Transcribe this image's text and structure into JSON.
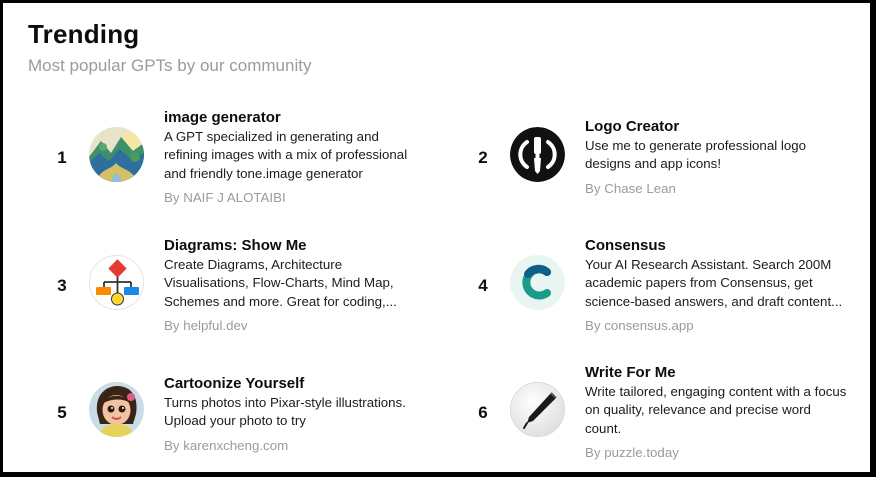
{
  "header": {
    "title": "Trending",
    "subtitle": "Most popular GPTs by our community"
  },
  "items": [
    {
      "rank": "1",
      "name": "image generator",
      "description": "A GPT specialized in generating and refining images with a mix of professional and friendly tone.image generator",
      "author": "By NAIF J ALOTAIBI",
      "icon": "landscape-painting-icon"
    },
    {
      "rank": "2",
      "name": "Logo Creator",
      "description": "Use me to generate professional logo designs and app icons!",
      "author": "By Chase Lean",
      "icon": "paintbrush-logo-icon"
    },
    {
      "rank": "3",
      "name": "Diagrams: Show Me",
      "description": "Create Diagrams, Architecture Visualisations, Flow-Charts, Mind Map, Schemes and more. Great for coding,...",
      "author": "By helpful.dev",
      "icon": "flowchart-icon"
    },
    {
      "rank": "4",
      "name": "Consensus",
      "description": "Your AI Research Assistant. Search 200M academic papers from Consensus, get science-based answers, and draft content...",
      "author": "By consensus.app",
      "icon": "consensus-c-icon"
    },
    {
      "rank": "5",
      "name": "Cartoonize Yourself",
      "description": "Turns photos into Pixar-style illustrations. Upload your photo to try",
      "author": "By karenxcheng.com",
      "icon": "cartoon-girl-icon"
    },
    {
      "rank": "6",
      "name": "Write For Me",
      "description": "Write tailored, engaging content with a focus on quality, relevance and precise word count.",
      "author": "By puzzle.today",
      "icon": "pen-nib-icon"
    }
  ]
}
